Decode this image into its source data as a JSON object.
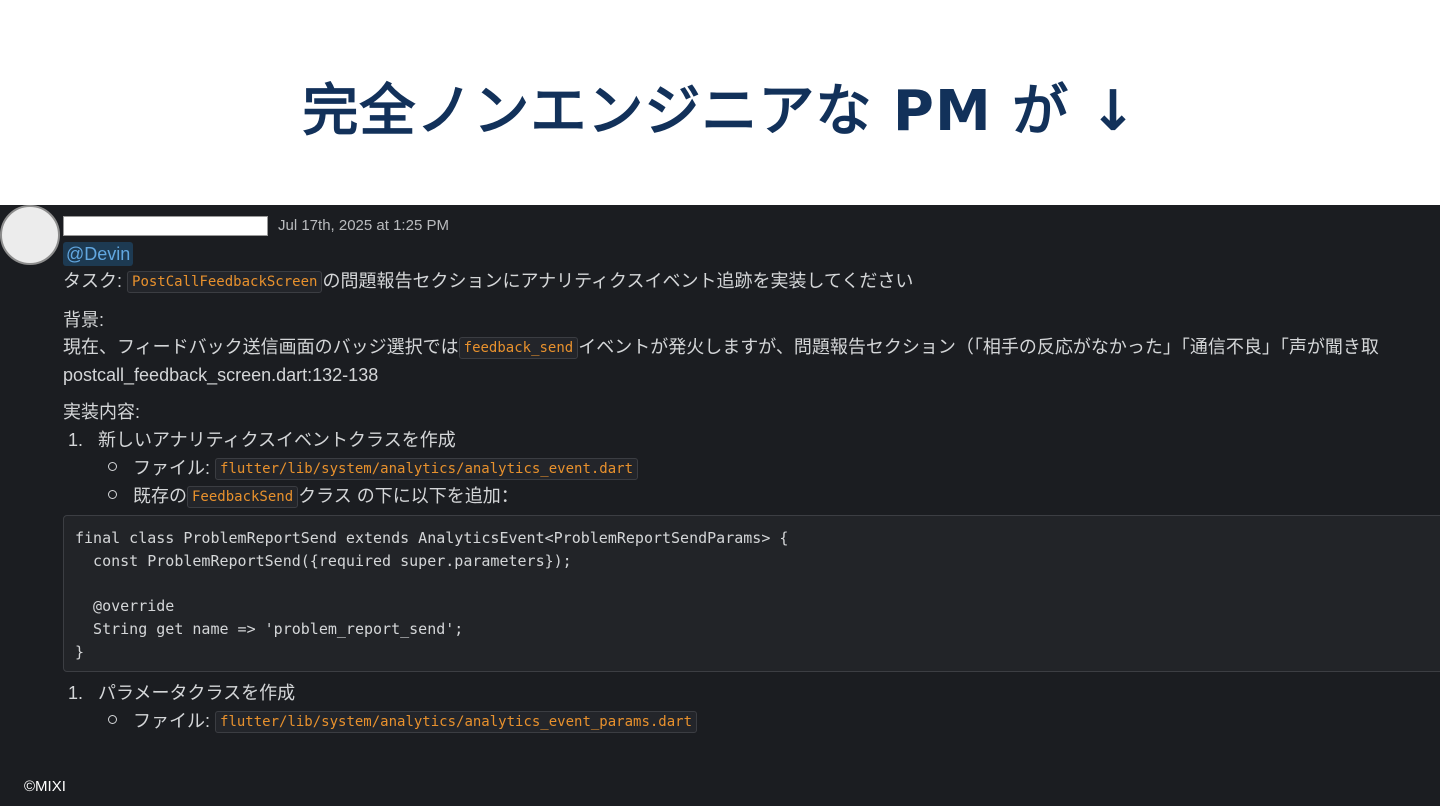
{
  "slide": {
    "title": "完全ノンエンジニアな PM が ↓",
    "copyright": "©MIXI"
  },
  "message": {
    "timestamp": "Jul 17th, 2025 at 1:25 PM",
    "mention": "@Devin",
    "task_prefix": "タスク: ",
    "task_code": "PostCallFeedbackScreen",
    "task_suffix": "の問題報告セクションにアナリティクスイベント追跡を実装してください",
    "background_heading": "背景:",
    "background_prefix": "現在、フィードバック送信画面のバッジ選択では",
    "background_code": "feedback_send",
    "background_suffix": "イベントが発火しますが、問題報告セクション（「相手の反応がなかった」「通信不良」「声が聞き取",
    "file_ref": "postcall_feedback_screen.dart:132-138",
    "impl_heading": "実装内容:",
    "step1_num": "1.",
    "step1_label": "新しいアナリティクスイベントクラスを作成",
    "step1_file_label": "ファイル: ",
    "step1_file_code": "flutter/lib/system/analytics/analytics_event.dart",
    "step1_existing_prefix": "既存の",
    "step1_existing_code": "FeedbackSend",
    "step1_existing_suffix": "クラス の下に以下を追加：",
    "code_block": "final class ProblemReportSend extends AnalyticsEvent<ProblemReportSendParams> {\n  const ProblemReportSend({required super.parameters});\n\n  @override\n  String get name => 'problem_report_send';\n}",
    "step2_num": "1.",
    "step2_label": "パラメータクラスを作成",
    "step2_file_label": "ファイル: ",
    "step2_file_code": "flutter/lib/system/analytics/analytics_event_params.dart"
  },
  "colors": {
    "title": "#12315a",
    "panel_bg": "#1b1d21",
    "inline_code": "#e8912d",
    "mention": "#62a7e0"
  }
}
